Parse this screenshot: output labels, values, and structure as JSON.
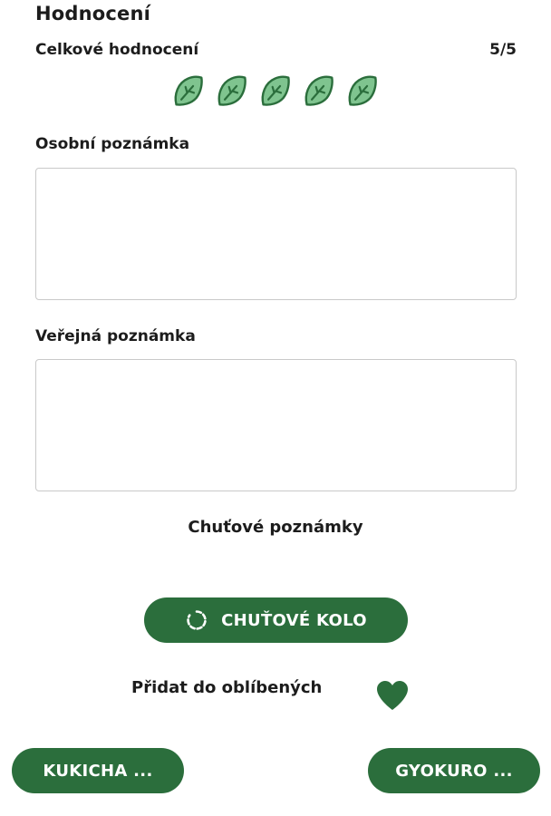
{
  "header": {
    "title": "Hodnocení"
  },
  "rating": {
    "label": "Celkové hodnocení",
    "value_text": "5/5",
    "value": 5,
    "max": 5,
    "icon": "leaf-icon",
    "color": "#2b6e3c",
    "fill_color": "#7fc48f"
  },
  "personal_note": {
    "label": "Osobní poznámka",
    "value": ""
  },
  "public_note": {
    "label": "Veřejná poznámka",
    "value": ""
  },
  "flavor": {
    "title": "Chuťové poznámky",
    "wheel_button_label": "CHUŤOVÉ KOLO",
    "wheel_icon": "refresh-icon"
  },
  "favorite": {
    "label": "Přidat do oblíbených",
    "icon": "heart-icon",
    "color": "#2b6e3c"
  },
  "navigation": {
    "prev_label": "KUKICHA ...",
    "next_label": "GYOKURO ..."
  },
  "colors": {
    "accent": "#2b6e3c",
    "border": "#c9c9c9"
  }
}
